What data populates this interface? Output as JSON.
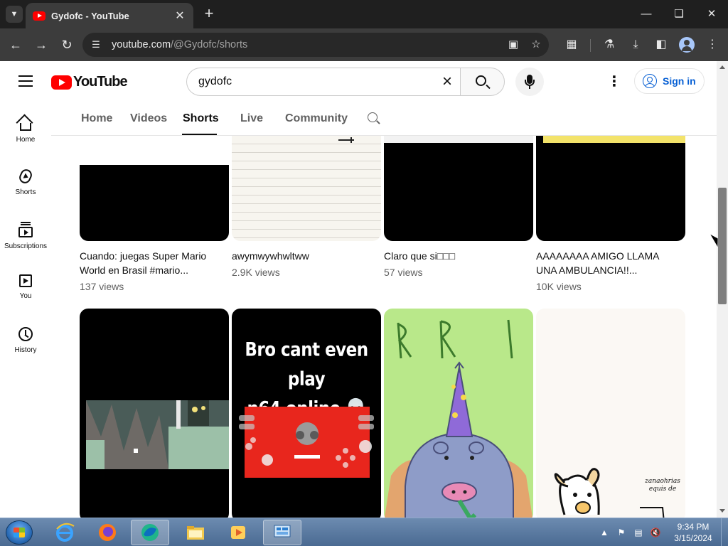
{
  "browser": {
    "tab_title": "Gydofc - YouTube",
    "url_host": "youtube.com",
    "url_path": "/@Gydofc/shorts"
  },
  "youtube": {
    "logo_text": "YouTube",
    "search_value": "gydofc",
    "signin_label": "Sign in",
    "sidebar": [
      {
        "label": "Home",
        "icon": "home-icon"
      },
      {
        "label": "Shorts",
        "icon": "shorts-icon"
      },
      {
        "label": "Subscriptions",
        "icon": "subscriptions-icon"
      },
      {
        "label": "You",
        "icon": "you-icon"
      },
      {
        "label": "History",
        "icon": "history-icon"
      }
    ],
    "channel_tabs": [
      "Home",
      "Videos",
      "Shorts",
      "Live",
      "Community"
    ],
    "active_tab": "Shorts",
    "shorts_row1": [
      {
        "title": "Cuando: juegas Super Mario World en Brasil #mario...",
        "views": "137 views"
      },
      {
        "title": "awymwywhwltww",
        "views": "2.9K views"
      },
      {
        "title": "Claro que si□□□",
        "views": "57 views"
      },
      {
        "title": "AAAAAAAA AMIGO LLAMA UNA AMBULANCIA!!...",
        "views": "10K views"
      }
    ],
    "shorts_row2_captions": {
      "n64_caption_line1": "Bro cant even play",
      "n64_caption_line2": "n64 online 💀",
      "drawing_caption_line1": "zanaohrias",
      "drawing_caption_line2": "equis de"
    }
  },
  "taskbar": {
    "time": "9:34 PM",
    "date": "3/15/2024"
  }
}
